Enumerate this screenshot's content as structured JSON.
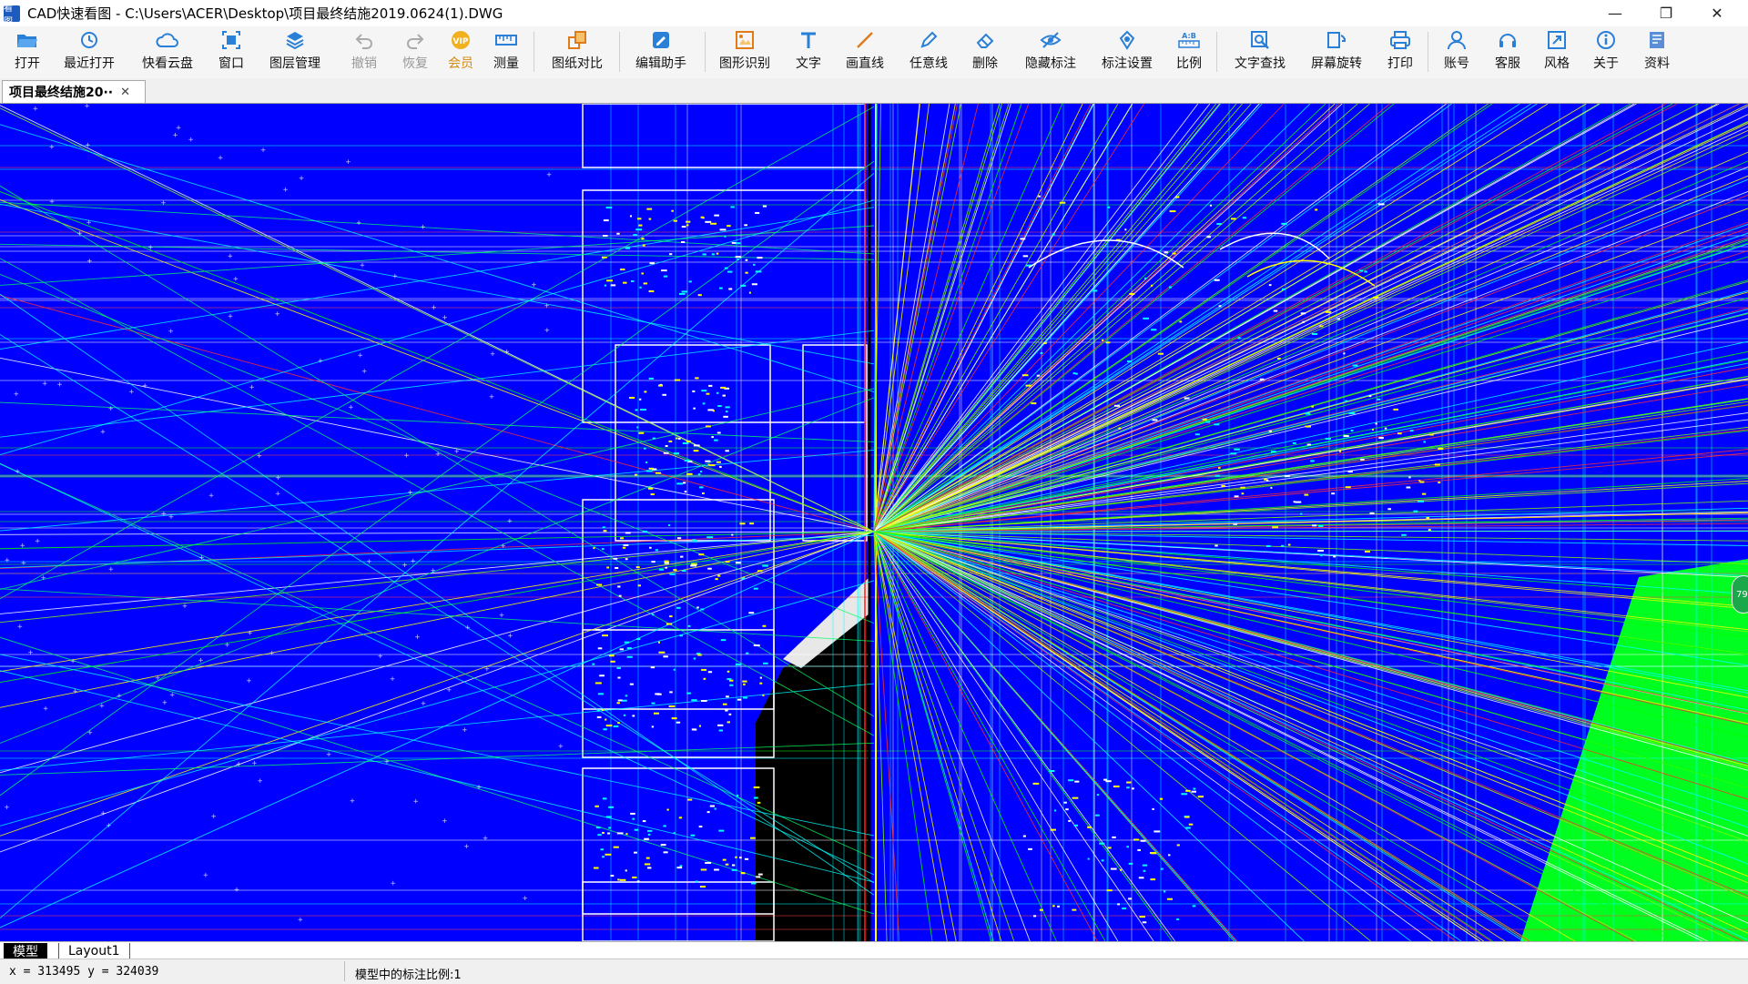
{
  "window": {
    "title": "CAD快速看图 - C:\\Users\\ACER\\Desktop\\项目最终结施2019.0624(1).DWG",
    "logo_text": "看图",
    "minimize": "—",
    "restore": "❐",
    "close": "✕"
  },
  "toolbar": {
    "open": "打开",
    "recent": "最近打开",
    "cloud": "快看云盘",
    "window": "窗口",
    "layers": "图层管理",
    "undo": "撤销",
    "redo": "恢复",
    "vip": "会员",
    "measure": "测量",
    "compare": "图纸对比",
    "edit_helper": "编辑助手",
    "recognize": "图形识别",
    "text": "文字",
    "line": "画直线",
    "freehand": "任意线",
    "delete": "删除",
    "hide_annot": "隐藏标注",
    "annot_settings": "标注设置",
    "scale": "比例",
    "find_text": "文字查找",
    "rotate": "屏幕旋转",
    "print": "打印",
    "account": "账号",
    "support": "客服",
    "style": "风格",
    "about": "关于",
    "resources": "资料"
  },
  "tabs": {
    "document": "项目最终结施20··",
    "close": "✕"
  },
  "canvas": {
    "background": "#0000ff",
    "handle_text": "79"
  },
  "layout_tabs": {
    "model": "模型",
    "layout1": "Layout1"
  },
  "status": {
    "coords": "x = 313495  y = 324039",
    "scale_text": "模型中的标注比例:1"
  }
}
